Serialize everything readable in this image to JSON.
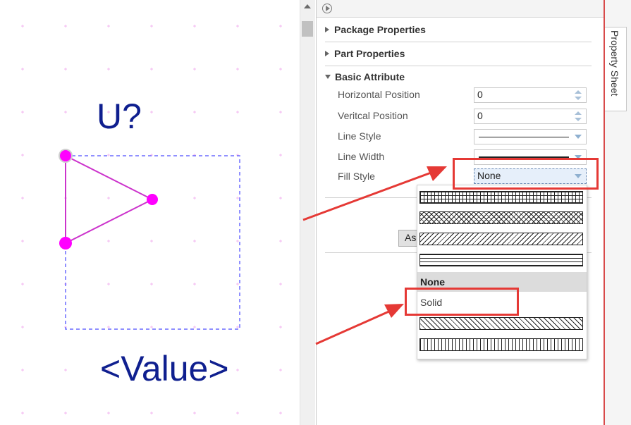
{
  "canvas": {
    "reference": "U?",
    "value": "<Value>"
  },
  "panel": {
    "sections": {
      "package": "Package Properties",
      "part": "Part Properties",
      "basic": "Basic Attribute"
    },
    "props": {
      "hpos_label": "Horizontal Position",
      "hpos_value": "0",
      "vpos_label": "Veritcal Position",
      "vpos_value": "0",
      "line_style_label": "Line Style",
      "line_width_label": "Line Width",
      "fill_style_label": "Fill Style",
      "fill_style_value": "None"
    },
    "assign_button": "As"
  },
  "dropdown": {
    "options": {
      "none": "None",
      "solid": "Solid"
    }
  },
  "right_tab": {
    "label": "Property Sheet"
  },
  "colors": {
    "annotation_red": "#e53935",
    "pin_magenta": "#ff00ff",
    "text_navy": "#0f1f8f"
  }
}
